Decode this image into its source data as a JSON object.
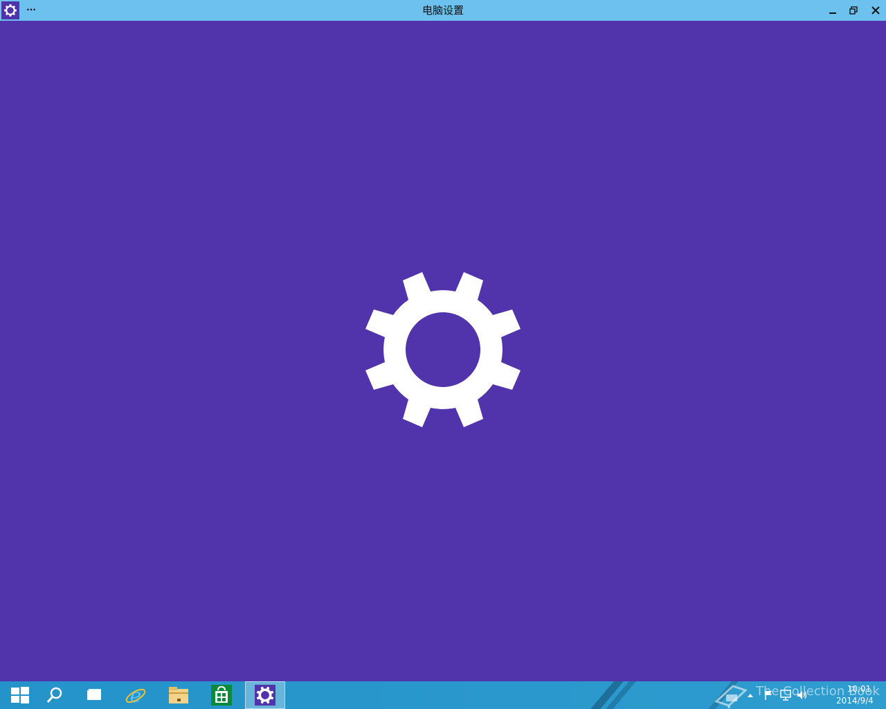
{
  "window": {
    "title": "电脑设置",
    "app_icon": "gear-icon",
    "more_label": "···",
    "buttons": {
      "minimize": "minimize-icon",
      "restore": "restore-icon",
      "close": "close-icon"
    }
  },
  "splash": {
    "icon": "gear-icon",
    "background_color": "#5133ab"
  },
  "taskbar": {
    "items": [
      {
        "name": "start",
        "icon": "windows-logo-icon"
      },
      {
        "name": "search",
        "icon": "search-icon"
      },
      {
        "name": "task-view",
        "icon": "task-view-icon"
      },
      {
        "name": "internet-explorer",
        "icon": "internet-explorer-icon"
      },
      {
        "name": "file-explorer",
        "icon": "folder-icon"
      },
      {
        "name": "store",
        "icon": "store-icon"
      },
      {
        "name": "pc-settings",
        "icon": "gear-icon",
        "active": true
      }
    ],
    "tray": {
      "icons": [
        "watermark-book-icon",
        "show-hidden-icons-icon",
        "action-center-flag-icon",
        "network-icon",
        "volume-icon"
      ],
      "watermark_text": "The Collection Book",
      "time": "10:01",
      "date": "2014/9/4"
    },
    "color": "#2a98cc"
  }
}
